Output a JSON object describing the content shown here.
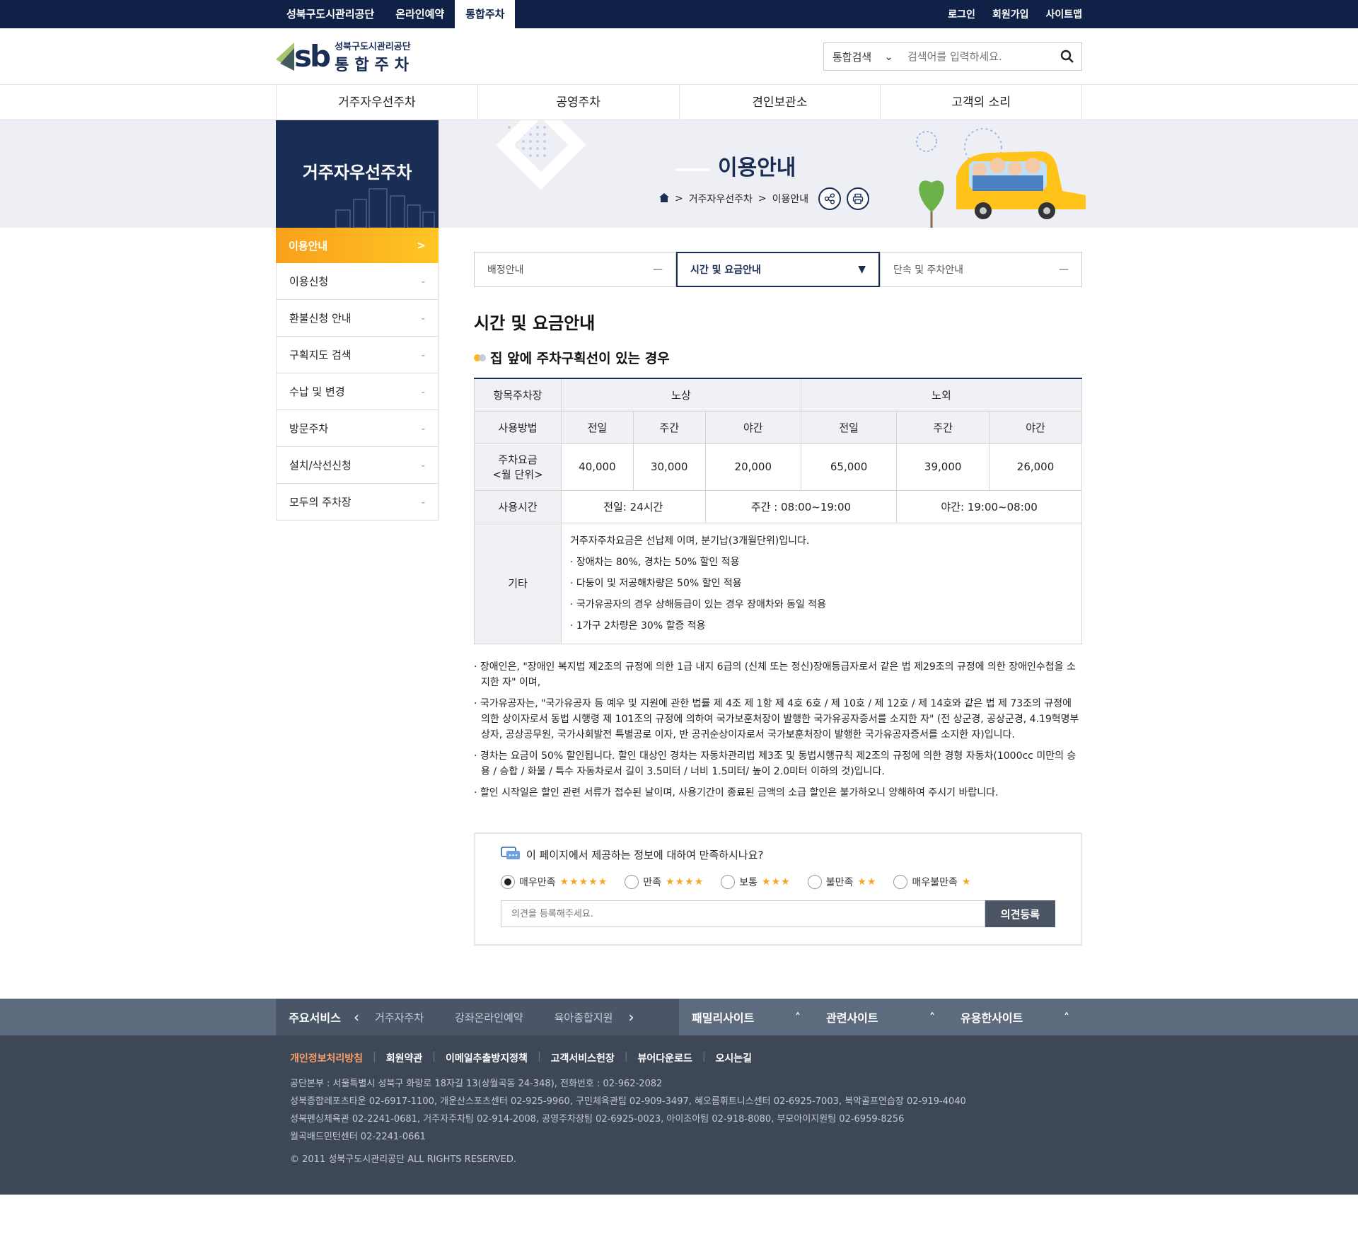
{
  "topbar": {
    "left": [
      "성북구도시관리공단",
      "온라인예약",
      "통합주차"
    ],
    "right": [
      "로그인",
      "회원가입",
      "사이트맵"
    ]
  },
  "logo": {
    "mark": "sb",
    "line1": "성북구도시관리공단",
    "line2": "통합주차"
  },
  "search": {
    "select": "통합검색",
    "placeholder": "검색어를 입력하세요."
  },
  "gnb": [
    "거주자우선주차",
    "공영주차",
    "견인보관소",
    "고객의 소리"
  ],
  "visual": {
    "section_title": "거주자우선주차",
    "page_title": "이용안내",
    "breadcrumb": [
      "거주자우선주차",
      "이용안내"
    ]
  },
  "lnb": [
    {
      "label": "이용안내",
      "active": true
    },
    {
      "label": "이용신청"
    },
    {
      "label": "환불신청 안내"
    },
    {
      "label": "구획지도 검색"
    },
    {
      "label": "수납 및 변경"
    },
    {
      "label": "방문주차"
    },
    {
      "label": "설치/삭선신청"
    },
    {
      "label": "모두의 주차장"
    }
  ],
  "tabs": [
    "배정안내",
    "시간 및 요금안내",
    "단속 및 주차안내"
  ],
  "h2": "시간 및 요금안내",
  "h3": "집 앞에 주차구획선이 있는 경우",
  "table": {
    "h_item": "항목주차장",
    "h_road": "노상",
    "h_offroad": "노외",
    "h_method": "사용방법",
    "sub": [
      "전일",
      "주간",
      "야간",
      "전일",
      "주간",
      "야간"
    ],
    "fee_label1": "주차요금",
    "fee_label2": "<월 단위>",
    "fees": [
      "40,000",
      "30,000",
      "20,000",
      "65,000",
      "39,000",
      "26,000"
    ],
    "time_label": "사용시간",
    "times": [
      "전일: 24시간",
      "주간 : 08:00~19:00",
      "야간: 19:00~08:00"
    ],
    "etc_label": "기타",
    "etc": [
      "거주자주차요금은 선납제 이며, 분기납(3개월단위)입니다.",
      "· 장애차는 80%, 경차는 50% 할인 적용",
      "· 다둥이 및 저공해차량은 50% 할인 적용",
      "· 국가유공자의 경우 상해등급이 있는 경우 장애차와 동일 적용",
      "· 1가구 2차량은 30% 할증 적용"
    ]
  },
  "notes": [
    "· 장애인은, \"장애인 복지법 제2조의 규정에 의한 1급 내지 6급의 (신체 또는 정신)장애등급자로서 같은 법 제29조의 규정에 의한 장애인수첩을 소지한 자\" 이며,",
    "· 국가유공자는, \"국가유공자 등 예우 및 지원에 관한 법률 제 4조 제 1항 제 4호 6호 / 제 10호 / 제 12호 / 제 14호와 같은 법 제 73조의 규정에 의한 상이자로서 동법 시행령 제 101조의 규정에 의하여 국가보훈처장이 발행한 국가유공자증서를 소지한 자\" (전 상군경, 공상군경, 4.19혁명부상자, 공상공무원, 국가사회발전 특별공로 이자, 반 공귀순상이자로서 국가보훈처장이 발행한 국가유공자증서를 소지한 자)입니다.",
    "· 경차는 요금이 50% 할인됩니다. 할인 대상인 경차는 자동차관리법 제3조 및 동법시행규칙 제2조의 규정에 의한 경형 자동차(1000cc 미만의 승용 / 승합 / 화물 / 특수 자동차로서 길이 3.5미터 / 너비 1.5미터/ 높이 2.0미터 이하의 것)입니다.",
    "· 할인 시작일은 할인 관련 서류가 접수된 날이며, 사용기간이 종료된 금액의 소급 할인은 불가하오니 양해하여 주시기 바랍니다."
  ],
  "survey": {
    "question": "이 페이지에서 제공하는 정보에 대하여 만족하시나요?",
    "options": [
      {
        "label": "매우만족",
        "stars": "★★★★★",
        "selected": true
      },
      {
        "label": "만족",
        "stars": "★★★★"
      },
      {
        "label": "보통",
        "stars": "★★★"
      },
      {
        "label": "불만족",
        "stars": "★★"
      },
      {
        "label": "매우불만족",
        "stars": "★"
      }
    ],
    "placeholder": "의견을 등록해주세요.",
    "submit": "의견등록"
  },
  "footer": {
    "services_title": "주요서비스",
    "services": [
      "거주자주차",
      "강좌온라인예약",
      "육아종합지원"
    ],
    "sites": [
      "패밀리사이트",
      "관련사이트",
      "유용한사이트"
    ],
    "links": [
      "개인정보처리방침",
      "회원약관",
      "이메일추출방지정책",
      "고객서비스헌장",
      "뷰어다운로드",
      "오시는길"
    ],
    "info": [
      "공단본부 : 서울특별시 성북구 화랑로 18자길 13(상월곡동 24-348), 전화번호 : 02-962-2082",
      "성북종합레포츠타운 02-6917-1100, 개운산스포츠센터 02-925-9960, 구민체육관팀 02-909-3497, 혜오름휘트니스센터 02-6925-7003, 북악골프연습장 02-919-4040",
      "성북펜싱체육관 02-2241-0681, 거주자주차팀 02-914-2008, 공영주차장팀 02-6925-0023, 아이조아팀 02-918-8080, 부모아이지원팀 02-6959-8256",
      "월곡배드민턴센터 02-2241-0661"
    ],
    "copyright": "© 2011 성북구도시관리공단 ALL RIGHTS RESERVED."
  },
  "colors": {
    "navy": "#1a2d55",
    "orange": "#f9a01b",
    "footer": "#3d4756"
  }
}
